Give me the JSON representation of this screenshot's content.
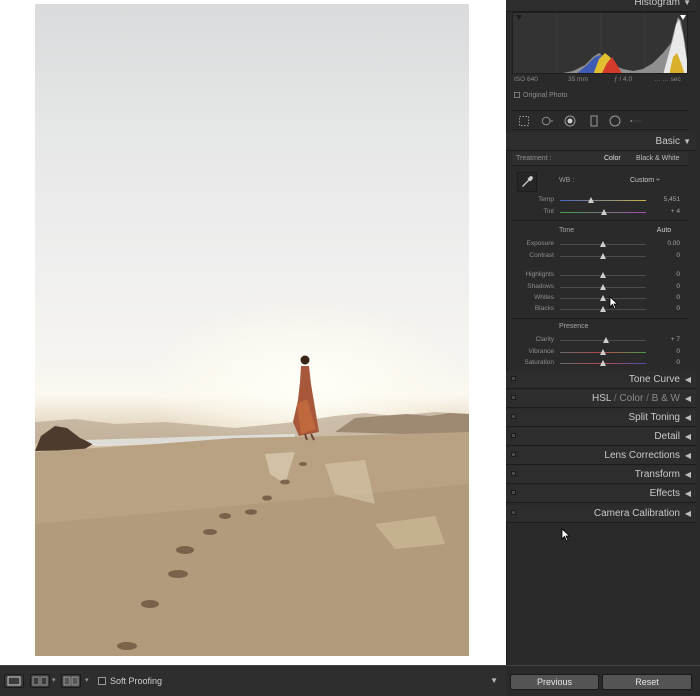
{
  "panels": {
    "histogram_title": "Histogram",
    "basic_title": "Basic",
    "tone_curve": "Tone Curve",
    "hsl": "HSL",
    "color": "Color",
    "bw": "B & W",
    "split_toning": "Split Toning",
    "detail": "Detail",
    "lens_corrections": "Lens Corrections",
    "transform": "Transform",
    "effects": "Effects",
    "camera_calibration": "Camera Calibration"
  },
  "histogram": {
    "iso": "ISO 640",
    "focal": "35 mm",
    "aperture": "ƒ / 4.0",
    "shutter": "… … sec",
    "original_photo": "Original Photo"
  },
  "basic": {
    "treatment_label": "Treatment :",
    "treatment_color": "Color",
    "treatment_bw": "Black & White",
    "wb_label": "WB :",
    "wb_value": "Custom ÷",
    "tone_label": "Tone",
    "auto": "Auto",
    "presence_label": "Presence",
    "sliders": {
      "temp": {
        "label": "Temp",
        "value": "5,451",
        "pos": 0.36
      },
      "tint": {
        "label": "Tint",
        "value": "+ 4",
        "pos": 0.51
      },
      "exposure": {
        "label": "Exposure",
        "value": "0.00",
        "pos": 0.5
      },
      "contrast": {
        "label": "Contrast",
        "value": "0",
        "pos": 0.5
      },
      "highlights": {
        "label": "Highlights",
        "value": "0",
        "pos": 0.5
      },
      "shadows": {
        "label": "Shadows",
        "value": "0",
        "pos": 0.5
      },
      "whites": {
        "label": "Whites",
        "value": "0",
        "pos": 0.5
      },
      "blacks": {
        "label": "Blacks",
        "value": "0",
        "pos": 0.5
      },
      "clarity": {
        "label": "Clarity",
        "value": "+ 7",
        "pos": 0.53
      },
      "vibrance": {
        "label": "Vibrance",
        "value": "0",
        "pos": 0.5
      },
      "saturation": {
        "label": "Saturation",
        "value": "0",
        "pos": 0.5
      }
    }
  },
  "toolbar": {
    "soft_proofing": "Soft Proofing"
  },
  "buttons": {
    "previous": "Previous",
    "reset": "Reset"
  },
  "colors": {
    "panel_bg": "#2a2a2a",
    "temp_gradient_start": "#4a66b8",
    "temp_gradient_end": "#c9b14a",
    "tint_gradient_start": "#3fa14a",
    "tint_gradient_end": "#a84bb0"
  }
}
